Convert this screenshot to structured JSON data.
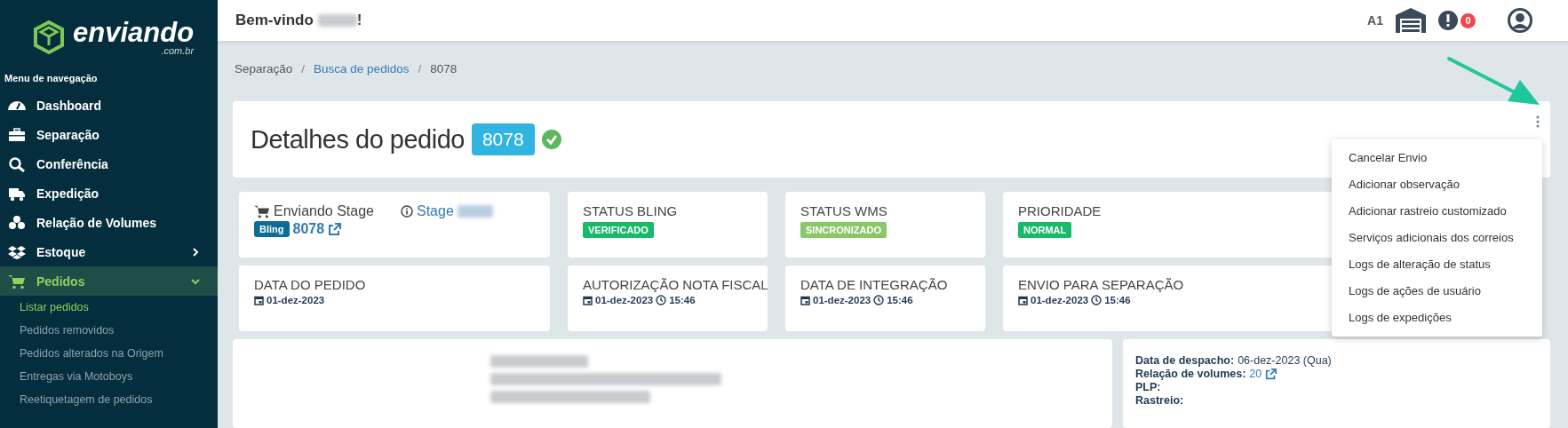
{
  "sidebar": {
    "logo": {
      "name": "enviando",
      "domain": ".com.br"
    },
    "section_title": "Menu de navegação",
    "items": [
      {
        "label": "Dashboard",
        "selected": false
      },
      {
        "label": "Separação",
        "selected": false
      },
      {
        "label": "Conferência",
        "selected": false
      },
      {
        "label": "Expedição",
        "selected": false
      },
      {
        "label": "Relação de Volumes",
        "selected": false
      },
      {
        "label": "Estoque",
        "expandable": true,
        "expanded": false,
        "selected": false
      },
      {
        "label": "Pedidos",
        "expandable": true,
        "expanded": true,
        "selected": true,
        "children": [
          {
            "label": "Listar pedidos",
            "selected": true
          },
          {
            "label": "Pedidos removidos",
            "selected": false
          },
          {
            "label": "Pedidos alterados na Origem",
            "selected": false
          },
          {
            "label": "Entregas via Motoboys",
            "selected": false
          },
          {
            "label": "Reetiquetagem de pedidos",
            "selected": false
          }
        ]
      }
    ]
  },
  "header": {
    "greeting": "Bem-vindo",
    "greeting_end": "!",
    "warehouse_code": "A1",
    "alerts_count": "0"
  },
  "breadcrumb_separator": "/",
  "breadcrumb": [
    {
      "label": "Separação",
      "link": false
    },
    {
      "label": "Busca de pedidos",
      "link": true
    },
    {
      "label": "8078",
      "link": false
    }
  ],
  "order": {
    "title": "Detalhes do pedido",
    "number": "8078",
    "verified": true
  },
  "menu": {
    "items": [
      "Cancelar Envio",
      "Adicionar observação",
      "Adicionar rastreio customizado",
      "Serviços adicionais dos correios",
      "Logs de alteração de status",
      "Logs de ações de usuário",
      "Logs de expedições"
    ]
  },
  "cards_row_1": [
    {
      "kind": "store",
      "store": "Enviando Stage",
      "info_link": "Stage",
      "source_badge": "Bling",
      "source_number": "8078"
    },
    {
      "kind": "status",
      "title": "STATUS BLING",
      "badge": "VERIFICADO",
      "color": "#19b96a"
    },
    {
      "kind": "status",
      "title": "STATUS WMS",
      "badge": "SINCRONIZADO",
      "color": "#8cc66a"
    },
    {
      "kind": "status",
      "title": "PRIORIDADE",
      "badge": "NORMAL",
      "color": "#19b96a"
    }
  ],
  "cards_row_2": [
    {
      "title": "DATA DO PEDIDO",
      "date": "01-dez-2023"
    },
    {
      "title": "AUTORIZAÇÃO NOTA FISCAL",
      "date": "01-dez-2023",
      "time": "15:46"
    },
    {
      "title": "DATA DE INTEGRAÇÃO",
      "date": "01-dez-2023",
      "time": "15:46"
    },
    {
      "title": "ENVIO PARA SEPARAÇÃO",
      "date": "01-dez-2023",
      "time": "15:46"
    }
  ],
  "shipping": [
    {
      "label": "Data de despacho:",
      "value": "06-dez-2023 (Qua)",
      "link": false
    },
    {
      "label": "Relação de volumes:",
      "value": "20",
      "link": true
    },
    {
      "label": "PLP:"
    },
    {
      "label": "Rastreio:"
    }
  ]
}
